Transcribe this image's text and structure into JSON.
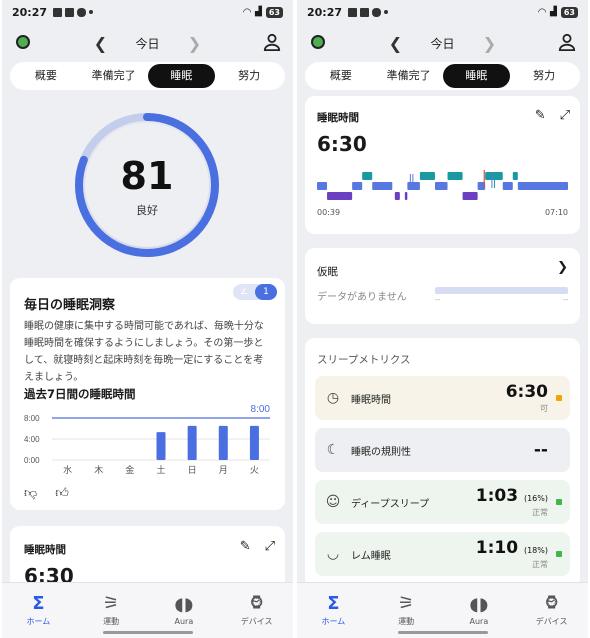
{
  "colors": {
    "accent": "#2a5ae8",
    "ring": "#4a6fe0",
    "ring_track": "#c5cdec",
    "hypnogram_light": "#5877e0",
    "hypnogram_deep": "#6b3fc2",
    "hypnogram_rem": "#1a9aa0",
    "status_warn": "#f0a500",
    "status_good": "#3fb54a"
  },
  "status_bar": {
    "time": "20:27",
    "battery": "63"
  },
  "header": {
    "day_label": "今日"
  },
  "tabs": [
    "概要",
    "準備完了",
    "睡眠",
    "努力"
  ],
  "active_tab": 2,
  "left": {
    "score": {
      "value": "81",
      "label": "良好",
      "fraction": 0.81
    },
    "insight": {
      "title": "毎日の睡眠洞察",
      "pager_current": "1",
      "body": "睡眠の健康に集中する時間可能であれば、毎晩十分な睡眠時間を確保するようにしましょう。その第一歩として、就寝時刻と起床時刻を毎晩一定にすることを考えましょう。"
    },
    "week_chart": {
      "title": "過去7日間の睡眠時間",
      "target_label": "8:00",
      "y_ticks": [
        "8:00",
        "4:00",
        "0:00"
      ]
    },
    "sleep_card": {
      "title": "睡眠時間",
      "time": "6:30"
    }
  },
  "right": {
    "sleep_card": {
      "title": "睡眠時間",
      "time": "6:30",
      "start": "00:39",
      "end": "07:10"
    },
    "nap": {
      "title": "仮眠",
      "no_data": "データがありません",
      "dash_left": "--",
      "dash_right": "--"
    },
    "metrics": {
      "title": "スリープメトリクス",
      "items": [
        {
          "label": "睡眠時間",
          "value": "6:30",
          "pct": "",
          "status": "可",
          "icon": "clock-zz-icon",
          "bg": "#f7f3e8",
          "sq": "#f0a500"
        },
        {
          "label": "睡眠の規則性",
          "value": "--",
          "pct": "",
          "status": "",
          "icon": "moon-icon",
          "bg": "#eeeff2",
          "sq": ""
        },
        {
          "label": "ディープスリープ",
          "value": "1:03",
          "pct": "(16%)",
          "status": "正常",
          "icon": "head-zz-icon",
          "bg": "#eef5ee",
          "sq": "#3fb54a"
        },
        {
          "label": "レム睡眠",
          "value": "1:10",
          "pct": "(18%)",
          "status": "正常",
          "icon": "eye-closed-icon",
          "bg": "#eef5ee",
          "sq": "#3fb54a"
        }
      ]
    }
  },
  "bottom_nav": [
    {
      "label": "ホーム",
      "icon": "sigma-icon",
      "active": true
    },
    {
      "label": "運動",
      "icon": "runner-icon",
      "active": false
    },
    {
      "label": "Aura",
      "icon": "aura-icon",
      "active": false
    },
    {
      "label": "デバイス",
      "icon": "watch-icon",
      "active": false
    }
  ],
  "chart_data": [
    {
      "type": "bar",
      "title": "過去7日間の睡眠時間",
      "categories": [
        "水",
        "木",
        "金",
        "土",
        "日",
        "月",
        "火"
      ],
      "values": [
        0,
        0,
        0,
        5.3,
        6.5,
        6.5,
        6.5
      ],
      "ylim": [
        0,
        8
      ],
      "y_ticks": [
        "8:00",
        "4:00",
        "0:00"
      ],
      "target": 8,
      "grid": true
    },
    {
      "type": "area",
      "title": "睡眠時間",
      "x_start": "00:39",
      "x_end": "07:10",
      "stages": [
        "rem",
        "light",
        "deep",
        "awake"
      ],
      "segments": [
        {
          "stage": "light",
          "from": 0.0,
          "to": 0.04
        },
        {
          "stage": "deep",
          "from": 0.04,
          "to": 0.14
        },
        {
          "stage": "light",
          "from": 0.14,
          "to": 0.18
        },
        {
          "stage": "rem",
          "from": 0.18,
          "to": 0.22
        },
        {
          "stage": "light",
          "from": 0.22,
          "to": 0.3
        },
        {
          "stage": "deep",
          "from": 0.31,
          "to": 0.33
        },
        {
          "stage": "deep",
          "from": 0.35,
          "to": 0.36
        },
        {
          "stage": "light",
          "from": 0.36,
          "to": 0.41
        },
        {
          "stage": "rem",
          "from": 0.41,
          "to": 0.47
        },
        {
          "stage": "light",
          "from": 0.47,
          "to": 0.52
        },
        {
          "stage": "rem",
          "from": 0.52,
          "to": 0.58
        },
        {
          "stage": "deep",
          "from": 0.58,
          "to": 0.64
        },
        {
          "stage": "light",
          "from": 0.64,
          "to": 0.67
        },
        {
          "stage": "awake",
          "from": 0.664,
          "to": 0.668
        },
        {
          "stage": "rem",
          "from": 0.67,
          "to": 0.74
        },
        {
          "stage": "light",
          "from": 0.74,
          "to": 0.78
        },
        {
          "stage": "rem",
          "from": 0.78,
          "to": 0.8
        },
        {
          "stage": "light",
          "from": 0.8,
          "to": 1.0
        }
      ]
    }
  ]
}
